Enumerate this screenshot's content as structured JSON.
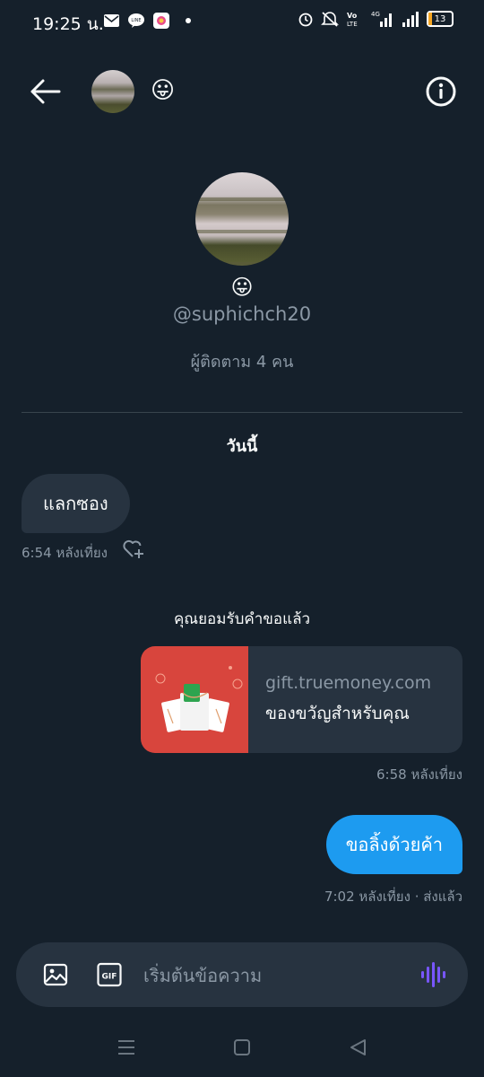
{
  "status_bar": {
    "time": "19:25 น.",
    "battery": "13",
    "network": "4G",
    "volte": "Vo LTE"
  },
  "header": {
    "emoji": "😛"
  },
  "profile": {
    "emoji": "😛",
    "handle": "@suphichch20",
    "followers": "ผู้ติดตาม 4 คน"
  },
  "date_divider": "วันนี้",
  "messages": {
    "incoming": {
      "text": "แลกซอง",
      "time": "6:54 หลังเที่ยง"
    },
    "system_note": "คุณยอมรับคำขอแล้ว",
    "link_card": {
      "domain": "gift.truemoney.com",
      "title": "ของขวัญสำหรับคุณ",
      "time": "6:58 หลังเที่ยง"
    },
    "outgoing": {
      "text": "ขอลิ้งด้วยค้า",
      "time": "7:02 หลังเที่ยง · ส่งแล้ว"
    }
  },
  "composer": {
    "placeholder": "เริ่มต้นข้อความ",
    "gif_label": "GIF"
  },
  "colors": {
    "background": "#15202b",
    "accent": "#1d9bf0",
    "bubble_in": "#273340",
    "muted": "#8b98a5"
  },
  "icons": [
    "mail-icon",
    "line-icon",
    "photos-icon",
    "alarm-icon",
    "mute-icon",
    "signal-icon",
    "battery-icon",
    "back-arrow-icon",
    "info-icon",
    "heart-plus-icon",
    "image-icon",
    "gif-icon",
    "voice-wave-icon",
    "nav-menu-icon",
    "nav-home-icon",
    "nav-back-icon"
  ]
}
